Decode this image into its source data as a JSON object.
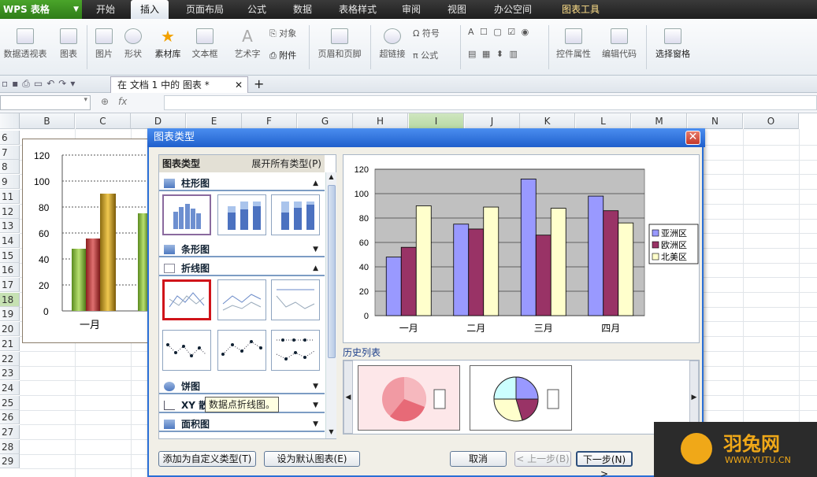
{
  "app": {
    "logo": "WPS 表格"
  },
  "menu_tabs": [
    {
      "label": "开始"
    },
    {
      "label": "插入"
    },
    {
      "label": "页面布局"
    },
    {
      "label": "公式"
    },
    {
      "label": "数据"
    },
    {
      "label": "表格样式"
    },
    {
      "label": "审阅"
    },
    {
      "label": "视图"
    },
    {
      "label": "办公空间"
    },
    {
      "label": "图表工具"
    }
  ],
  "ribbon": {
    "pivot": "数据透视表",
    "chart": "图表",
    "picture": "图片",
    "shape": "形状",
    "material": "素材库",
    "textbox": "文本框",
    "wordart": "艺术字",
    "object": "对象",
    "attachment": "附件",
    "header_footer": "页眉和页脚",
    "hyperlink": "超链接",
    "symbol": "符号",
    "formula": "公式",
    "control_props": "控件属性",
    "edit_code": "编辑代码",
    "select_pane": "选择窗格"
  },
  "doc_tab": {
    "label": "在 文档 1 中的 图表 *",
    "close": "✕",
    "new": "+"
  },
  "formula_bar": {
    "fx": "fx"
  },
  "columns": [
    "B",
    "C",
    "D",
    "E",
    "F",
    "G",
    "H",
    "I",
    "J",
    "K",
    "L",
    "M",
    "N",
    "O"
  ],
  "rows": [
    "6",
    "7",
    "8",
    "9",
    "11",
    "12",
    "13",
    "14",
    "15",
    "16",
    "17",
    "18",
    "19",
    "20",
    "21",
    "22",
    "23",
    "24",
    "25",
    "26",
    "27",
    "28",
    "29"
  ],
  "embedded_chart": {
    "yticks": [
      "120",
      "100",
      "80",
      "60",
      "40",
      "20",
      "0"
    ],
    "xlabel": "一月"
  },
  "dialog": {
    "title": "图表类型",
    "close": "✕",
    "list_header": "图表类型",
    "expand_all": "展开所有类型(P)",
    "categories": [
      {
        "label": "柱形图",
        "arrow": "▲"
      },
      {
        "label": "条形图",
        "arrow": "▼"
      },
      {
        "label": "折线图",
        "arrow": "▲"
      },
      {
        "label": "饼图",
        "arrow": "▼"
      },
      {
        "label": "XY 散点图",
        "arrow": "▼"
      },
      {
        "label": "面积图",
        "arrow": "▼"
      }
    ],
    "tooltip": "数据点折线图。",
    "history_label": "历史列表",
    "buttons": {
      "add_custom": "添加为自定义类型(T)",
      "set_default": "设为默认图表(E)",
      "cancel": "取消",
      "prev": "< 上一步(B)",
      "next": "下一步(N) >"
    }
  },
  "chart_data": {
    "type": "bar",
    "categories": [
      "一月",
      "二月",
      "三月",
      "四月"
    ],
    "series": [
      {
        "name": "亚洲区",
        "color": "#9999ff",
        "values": [
          48,
          75,
          112,
          98
        ]
      },
      {
        "name": "欧洲区",
        "color": "#993366",
        "values": [
          56,
          71,
          66,
          86
        ]
      },
      {
        "name": "北美区",
        "color": "#ffffcc",
        "values": [
          90,
          89,
          88,
          76
        ]
      }
    ],
    "ylim": [
      0,
      120
    ],
    "yticks": [
      0,
      20,
      40,
      60,
      80,
      100,
      120
    ],
    "legend": "right",
    "plot_background": "#c0c0c0",
    "grid": true
  },
  "watermark": {
    "text": "羽兔网",
    "url": "WWW.YUTU.CN"
  }
}
